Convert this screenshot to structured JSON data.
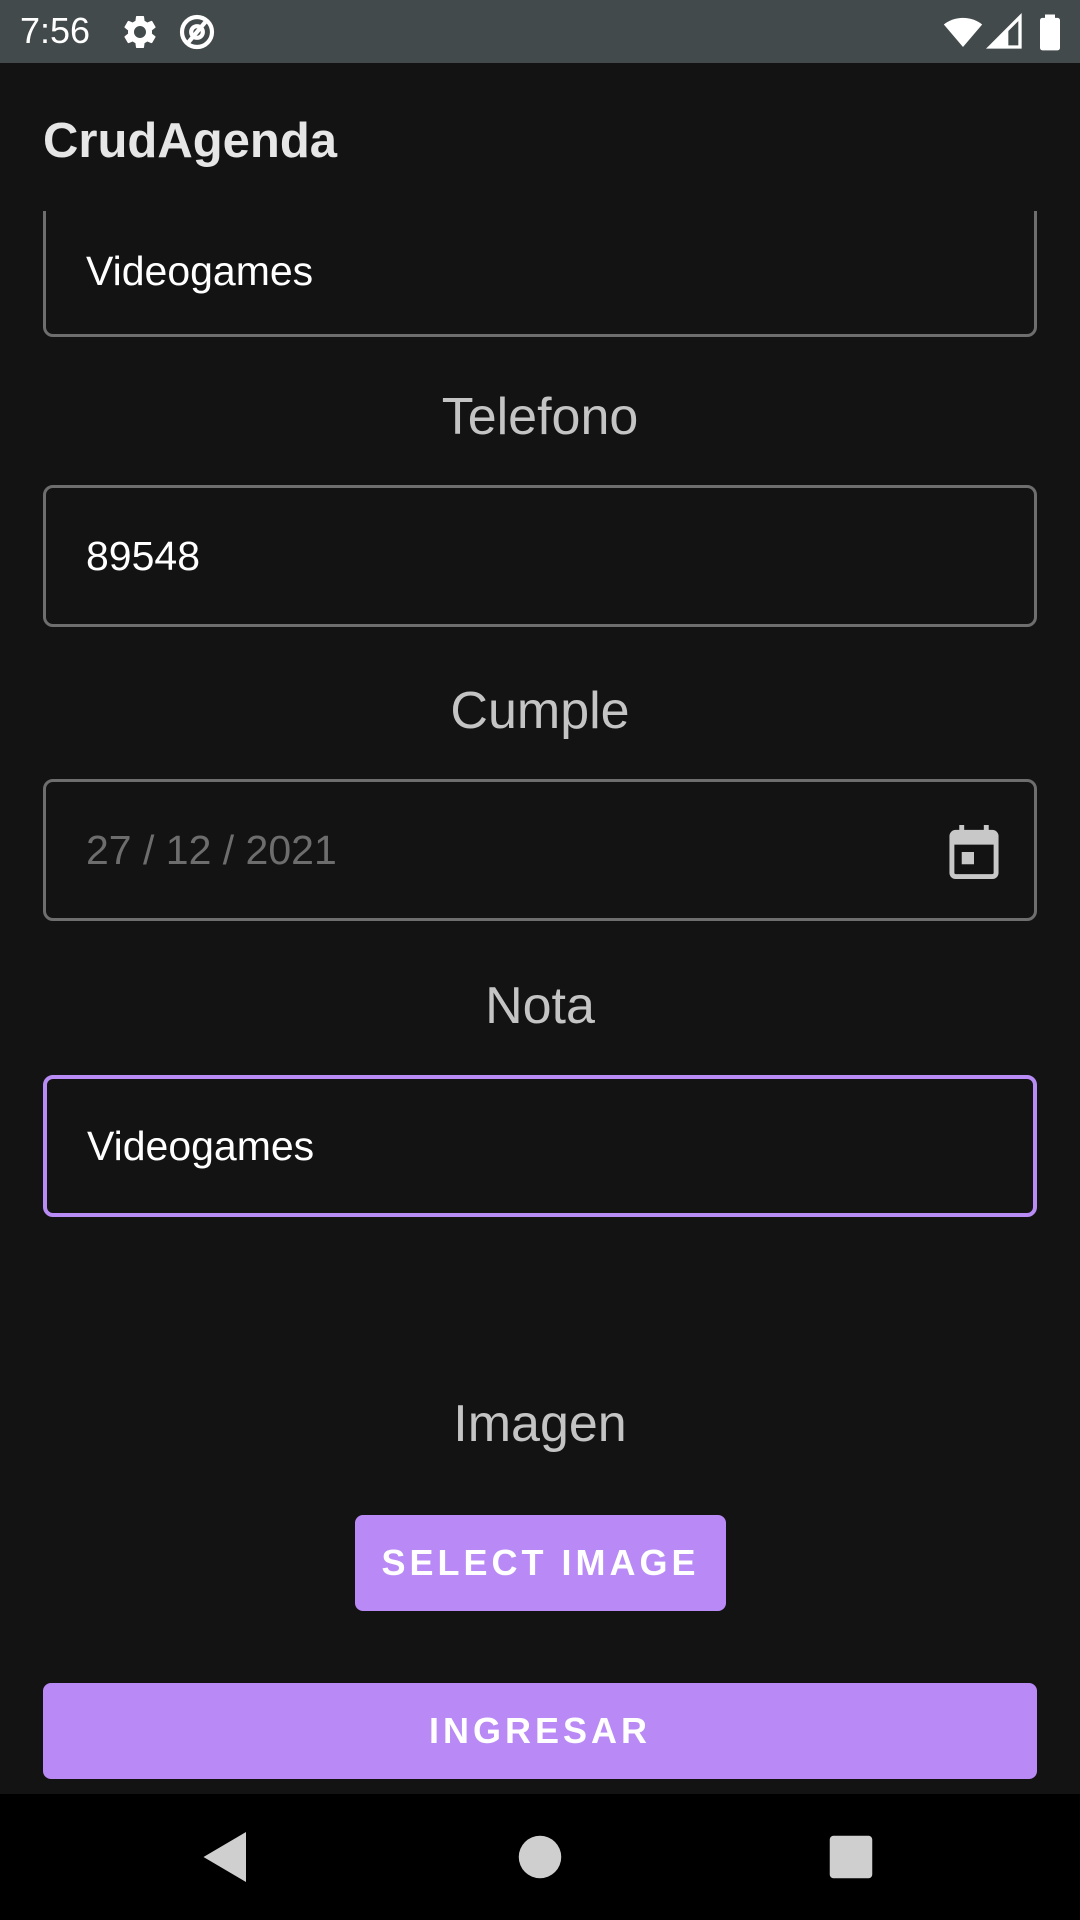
{
  "status_bar": {
    "time": "7:56",
    "icons": [
      "settings-icon",
      "data-saver-icon",
      "wifi-icon",
      "signal-icon",
      "battery-icon"
    ]
  },
  "app_bar": {
    "title": "CrudAgenda"
  },
  "form": {
    "fields": [
      {
        "label": "",
        "value": "Videogames"
      },
      {
        "label": "Telefono",
        "value": "89548"
      },
      {
        "label": "Cumple",
        "value": "27 / 12 / 2021",
        "icon": "calendar-icon"
      },
      {
        "label": "Nota",
        "value": "Videogames"
      }
    ],
    "image_label": "Imagen",
    "select_image_button": "SELECT IMAGE",
    "submit_button": "INGRESAR"
  },
  "nav_bar": {
    "icons": [
      "back-icon",
      "home-icon",
      "recents-icon"
    ]
  },
  "colors": {
    "accent": "#b98af5",
    "background": "#131313",
    "status_bar": "#434a4b",
    "field_border": "#6e6e6e"
  }
}
